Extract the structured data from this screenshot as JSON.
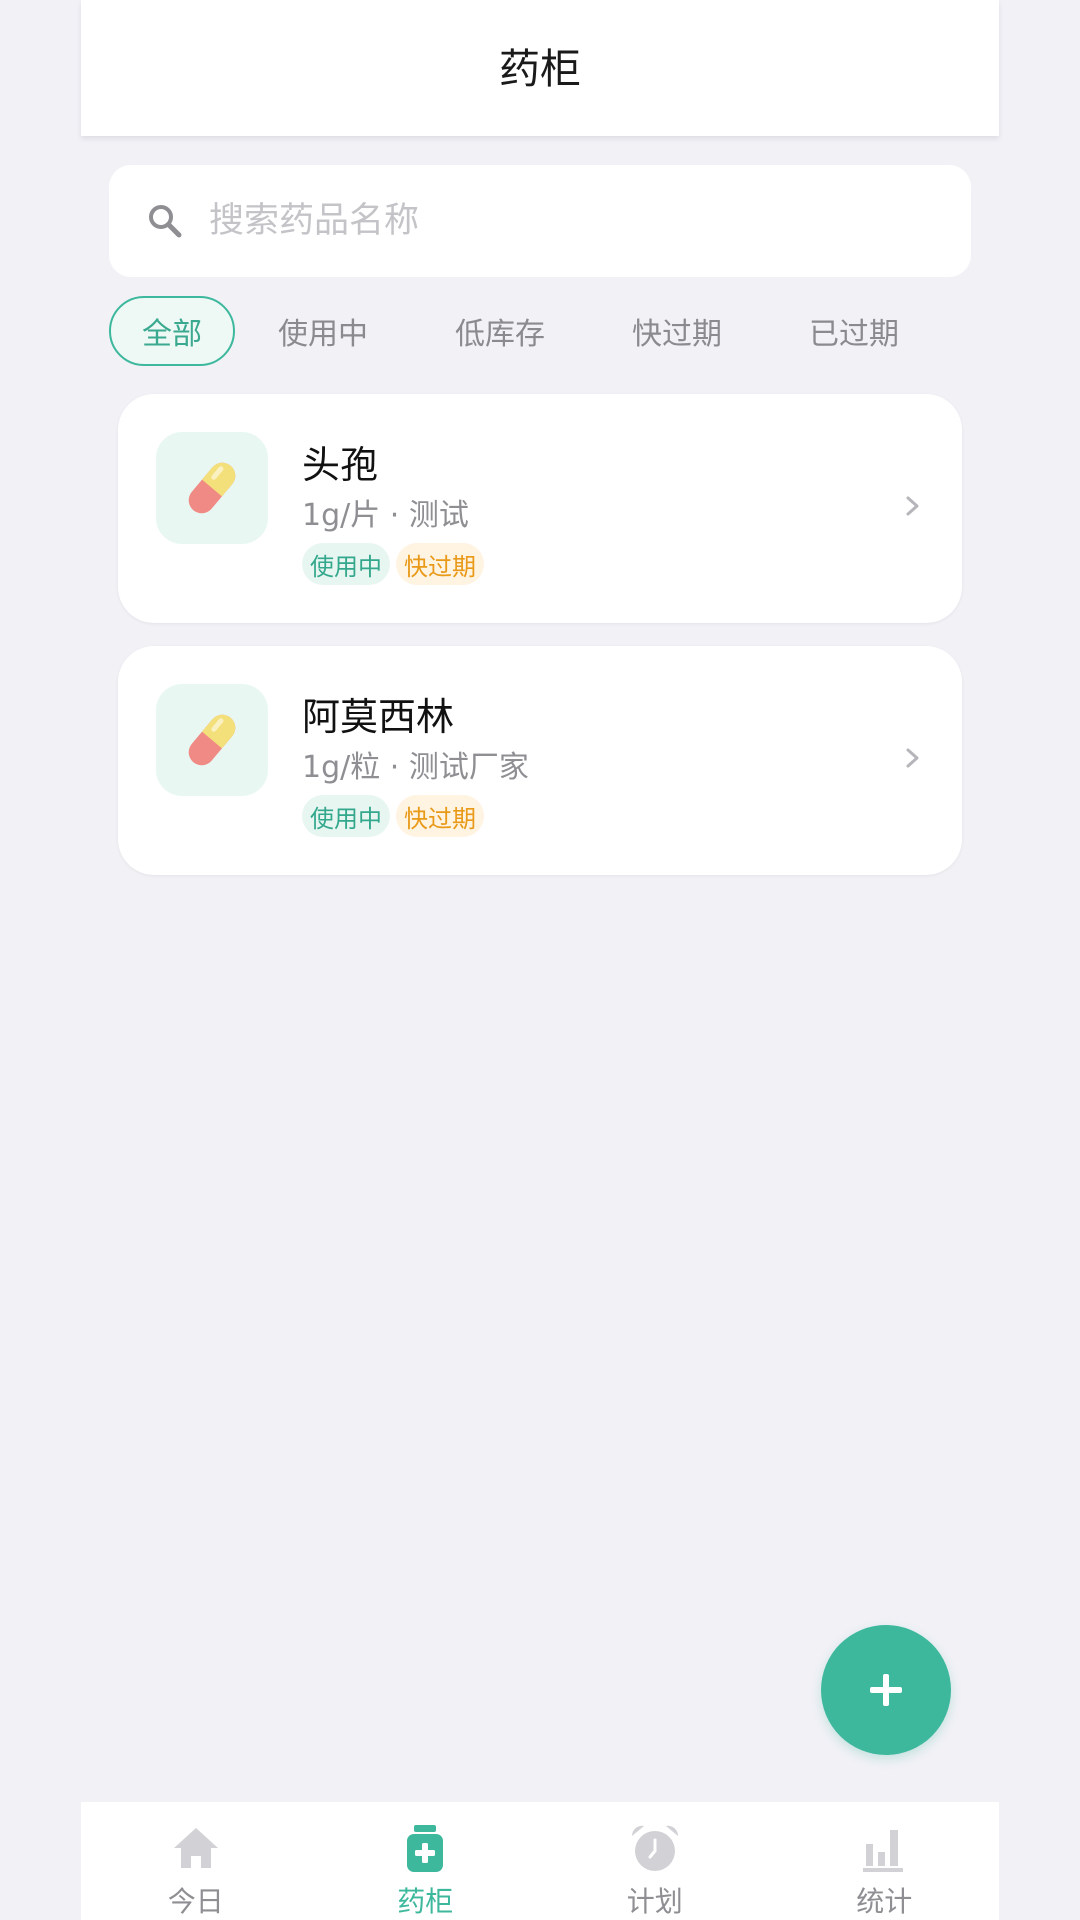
{
  "header": {
    "title": "药柜"
  },
  "search": {
    "placeholder": "搜索药品名称",
    "icon": "search-icon"
  },
  "filters": [
    {
      "label": "全部",
      "active": true
    },
    {
      "label": "使用中",
      "active": false
    },
    {
      "label": "低库存",
      "active": false
    },
    {
      "label": "快过期",
      "active": false
    },
    {
      "label": "已过期",
      "active": false
    }
  ],
  "medicines": [
    {
      "name": "头孢",
      "meta": "1g/片 · 测试",
      "tags": [
        "使用中",
        "快过期"
      ],
      "icon": "pill-icon"
    },
    {
      "name": "阿莫西林",
      "meta": "1g/粒 · 测试厂家",
      "tags": [
        "使用中",
        "快过期"
      ],
      "icon": "pill-icon"
    }
  ],
  "fab": {
    "label": "+",
    "icon": "plus-icon"
  },
  "tabbar": [
    {
      "label": "今日",
      "icon": "home-icon",
      "active": false
    },
    {
      "label": "药柜",
      "icon": "medicine-bottle-icon",
      "active": true
    },
    {
      "label": "计划",
      "icon": "alarm-clock-icon",
      "active": false
    },
    {
      "label": "统计",
      "icon": "bar-chart-icon",
      "active": false
    }
  ],
  "colors": {
    "accent": "#3db89d",
    "warning": "#e89a18",
    "background": "#f1f1f6"
  }
}
